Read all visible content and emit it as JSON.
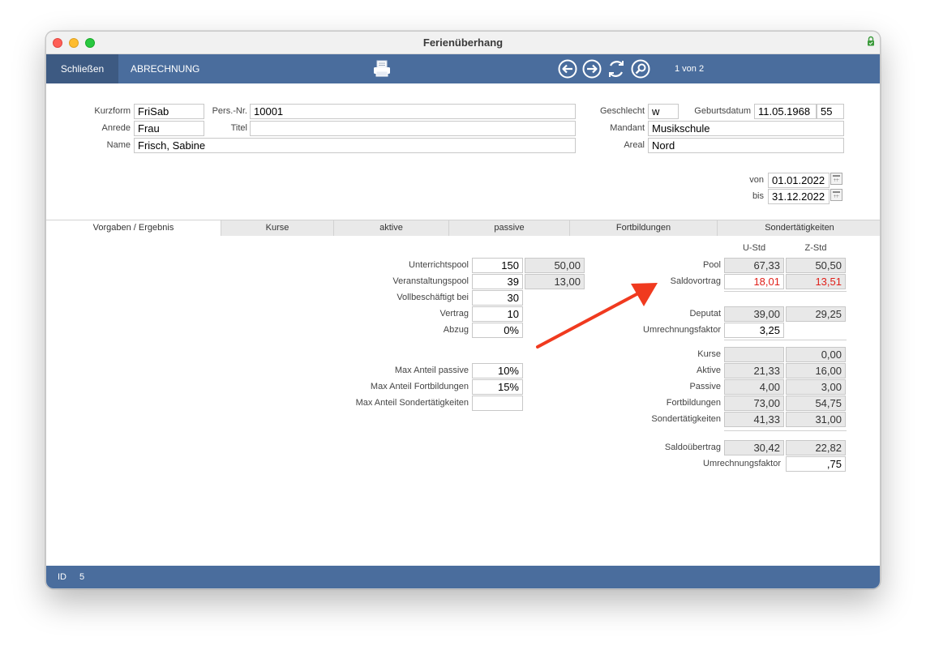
{
  "window": {
    "title": "Ferienüberhang"
  },
  "toolbar": {
    "close_label": "Schließen",
    "abrechnung_label": "ABRECHNUNG",
    "record_count": "1 von 2"
  },
  "header": {
    "kurzform": {
      "label": "Kurzform",
      "value": "FriSab"
    },
    "persnr": {
      "label": "Pers.-Nr.",
      "value": "10001"
    },
    "anrede": {
      "label": "Anrede",
      "value": "Frau"
    },
    "titel": {
      "label": "Titel",
      "value": ""
    },
    "name": {
      "label": "Name",
      "value": "Frisch, Sabine"
    },
    "geschlecht": {
      "label": "Geschlecht",
      "value": "w"
    },
    "geburtsdatum": {
      "label": "Geburtsdatum",
      "value": "11.05.1968",
      "age": "55"
    },
    "mandant": {
      "label": "Mandant",
      "value": "Musikschule"
    },
    "areal": {
      "label": "Areal",
      "value": "Nord"
    },
    "von": {
      "label": "von",
      "value": "01.01.2022"
    },
    "bis": {
      "label": "bis",
      "value": "31.12.2022"
    }
  },
  "tabs": [
    "Vorgaben / Ergebnis",
    "Kurse",
    "aktive",
    "passive",
    "Fortbildungen",
    "Sondertätigkeiten"
  ],
  "left": {
    "unterrichtspool": {
      "label": "Unterrichtspool",
      "value": "150",
      "calc": "50,00"
    },
    "veranstaltungspool": {
      "label": "Veranstaltungspool",
      "value": "39",
      "calc": "13,00"
    },
    "vollbeschaeftigt": {
      "label": "Vollbeschäftigt bei",
      "value": "30"
    },
    "vertrag": {
      "label": "Vertrag",
      "value": "10"
    },
    "abzug": {
      "label": "Abzug",
      "value": "0%"
    },
    "max_passive": {
      "label": "Max Anteil passive",
      "value": "10%"
    },
    "max_fortbildungen": {
      "label": "Max Anteil Fortbildungen",
      "value": "15%"
    },
    "max_sonder": {
      "label": "Max Anteil Sondertätigkeiten",
      "value": ""
    }
  },
  "right": {
    "col_u": "U-Std",
    "col_z": "Z-Std",
    "pool": {
      "label": "Pool",
      "u": "67,33",
      "z": "50,50"
    },
    "saldovortrag": {
      "label": "Saldovortrag",
      "u": "18,01",
      "z": "13,51"
    },
    "deputat": {
      "label": "Deputat",
      "u": "39,00",
      "z": "29,25"
    },
    "umrechnung1": {
      "label": "Umrechnungsfaktor",
      "u": "3,25"
    },
    "kurse": {
      "label": "Kurse",
      "u": "",
      "z": "0,00"
    },
    "aktive": {
      "label": "Aktive",
      "u": "21,33",
      "z": "16,00"
    },
    "passive": {
      "label": "Passive",
      "u": "4,00",
      "z": "3,00"
    },
    "fortbildungen": {
      "label": "Fortbildungen",
      "u": "73,00",
      "z": "54,75"
    },
    "sonder": {
      "label": "Sondertätigkeiten",
      "u": "41,33",
      "z": "31,00"
    },
    "saldouebertrag": {
      "label": "Saldoübertrag",
      "u": "30,42",
      "z": "22,82"
    },
    "umrechnung2": {
      "label": "Umrechnungsfaktor",
      "z": ",75"
    }
  },
  "status": {
    "id_label": "ID",
    "id_value": "5"
  },
  "colors": {
    "toolbar": "#4a6d9d",
    "toolbar_active": "#3d5a82",
    "alert_red": "#e0201a",
    "arrow": "#f03a1f"
  },
  "icons": [
    "print-icon",
    "arrow-left-icon",
    "arrow-right-icon",
    "refresh-icon",
    "search-icon",
    "lock-icon",
    "calendar-icon"
  ]
}
